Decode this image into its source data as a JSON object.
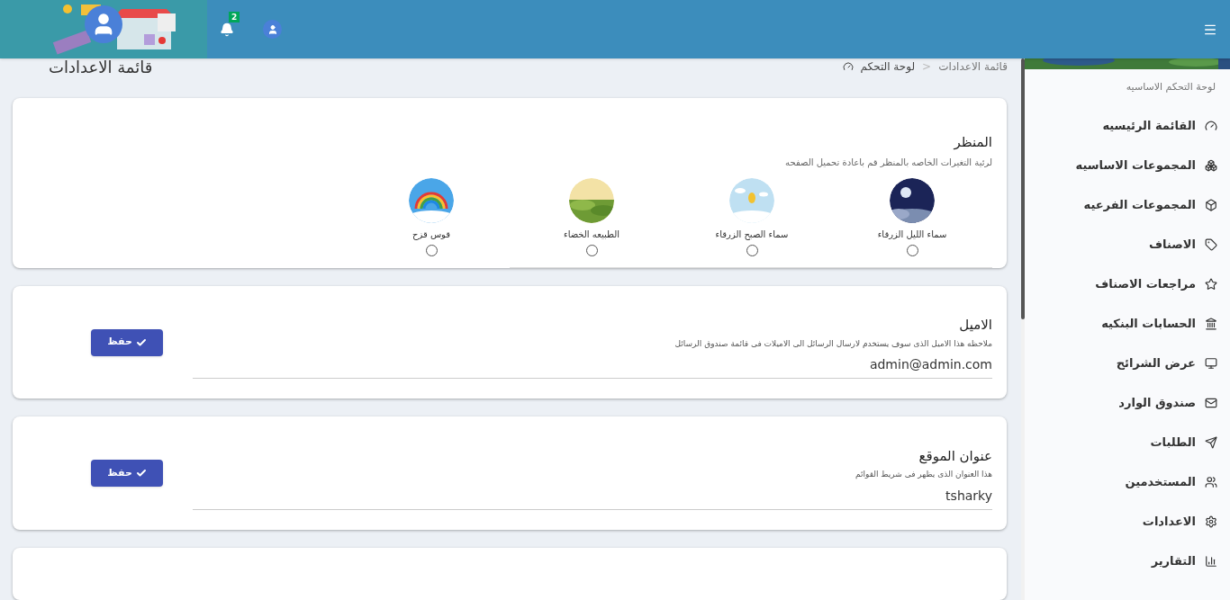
{
  "header": {
    "notifications_count": "2"
  },
  "page": {
    "title": "قائمة الاعدادات",
    "breadcrumb_separator": "<",
    "breadcrumb": [
      {
        "label": "قائمة الاعدادات"
      },
      {
        "label": "لوحة التحكم"
      }
    ]
  },
  "sidebar": {
    "heading": "لوحة التحكم الاساسيه",
    "items": [
      {
        "label": "القائمة الرئيسيه"
      },
      {
        "label": "المجموعات الاساسيه"
      },
      {
        "label": "المجموعات الفرعيه"
      },
      {
        "label": "الاصناف"
      },
      {
        "label": "مراجعات الاصناف"
      },
      {
        "label": "الحسابات البنكيه"
      },
      {
        "label": "عرض الشرائح"
      },
      {
        "label": "صندوق الوارد"
      },
      {
        "label": "الطلبات"
      },
      {
        "label": "المستخدمين"
      },
      {
        "label": "الاعدادات"
      },
      {
        "label": "التقارير"
      }
    ]
  },
  "theme": {
    "title": "المنظر",
    "note": "لرئية التغيرات الخاصه بالمنظر قم باعادة تحميل الصفحه",
    "options": [
      {
        "label": "سماء الليل الزرقاء",
        "kind": "night",
        "selected": false
      },
      {
        "label": "سماء الصبح الزرقاء",
        "kind": "day",
        "selected": false
      },
      {
        "label": "الطبيعه الخضاء",
        "kind": "nature",
        "selected": false
      },
      {
        "label": "قوس قزح",
        "kind": "rainbow",
        "selected": false
      }
    ]
  },
  "settings": [
    {
      "title": "الاميل",
      "note": "ملاحظه هذا الاميل الذى سوف يستخدم لارسال الرسائل الى الاميلات فى قائمة صندوق الرسائل",
      "value": "admin@admin.com",
      "button": "حفظ"
    },
    {
      "title": "عنوان الموقع",
      "note": "هذا العنوان الذى يظهر فى شريط القوائم",
      "value": "tsharky",
      "button": "حفظ"
    }
  ]
}
